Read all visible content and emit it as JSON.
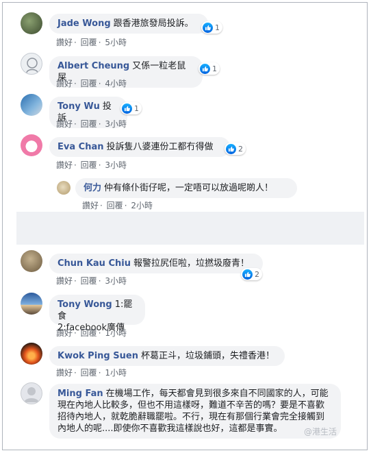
{
  "comments": [
    {
      "name": "Jade Wong",
      "text": "跟香港旅發局投訴。",
      "likes": "1",
      "actions": {
        "like": "讚好",
        "reply": "回覆",
        "time": "5小時"
      }
    },
    {
      "name": "Albert Cheung",
      "text": "又係一粒老鼠屎",
      "likes": "1",
      "actions": {
        "like": "讚好",
        "reply": "回覆",
        "time": "4小時"
      }
    },
    {
      "name": "Tony Wu",
      "text": "投訴",
      "likes": "1",
      "actions": {
        "like": "讚好",
        "reply": "回覆",
        "time": "3小時"
      }
    },
    {
      "name": "Eva Chan",
      "text": "投訴隻八婆連份工都冇得做",
      "likes": "2",
      "actions": {
        "like": "讚好",
        "reply": "回覆",
        "time": "3小時"
      }
    },
    {
      "name": "何力",
      "text": "仲有條仆街仔呢，一定唔可以放過呢啲人！",
      "actions": {
        "like": "讚好",
        "reply": "回覆",
        "time": "2小時"
      }
    },
    {
      "name": "Chun Kau Chiu",
      "text": "報警拉尻佢啦，垃撚圾廢青！",
      "likes": "2",
      "actions": {
        "like": "讚好",
        "reply": "回覆",
        "time": "3小時"
      }
    },
    {
      "name": "Tony Wong",
      "text": "1:罷食\n2:facebook廣傳",
      "actions": {
        "like": "讚好",
        "reply": "回覆",
        "time": "1小時"
      }
    },
    {
      "name": "Kwok Ping Suen",
      "text": "杯葛正斗，垃圾鋪頭，失禮香港！",
      "actions": {
        "like": "讚好",
        "reply": "回覆",
        "time": "1小時"
      }
    },
    {
      "name": "Ming Fan",
      "text": "在機場工作，每天都會見到很多來自不同國家的人，可能現在內地人比較多，但也不用這樣呀，難道不辛苦的嗎？要是不喜歡招待內地人，就乾脆辭職罷啦。不行，現在有那個行業會完全接觸到內地人的呢....即使你不喜歡我這樣說也好，這都是事實。"
    }
  ],
  "separator": "·",
  "watermark": "@港生活",
  "colors": {
    "name": "#385898",
    "bubble": "#f2f3f5",
    "meta": "#606770",
    "like": "#1877f2"
  }
}
